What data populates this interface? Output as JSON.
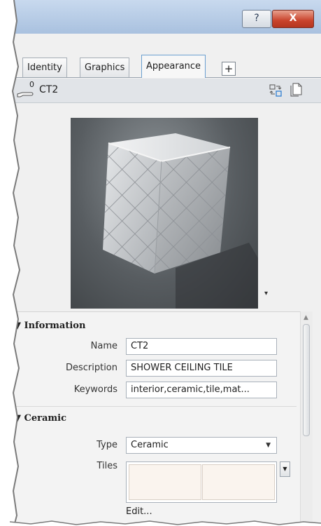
{
  "titlebar": {
    "help_label": "?",
    "close_label": "X"
  },
  "tabs": [
    {
      "label": "Identity",
      "active": false
    },
    {
      "label": "Graphics",
      "active": false
    },
    {
      "label": "Appearance",
      "active": true
    }
  ],
  "add_tab_label": "+",
  "asset": {
    "count": "0",
    "name": "CT2"
  },
  "information": {
    "header": "Information",
    "rows": [
      {
        "label": "Name",
        "value": "CT2"
      },
      {
        "label": "Description",
        "value": "SHOWER CEILING TILE"
      },
      {
        "label": "Keywords",
        "value": "interior,ceramic,tile,mat..."
      }
    ]
  },
  "ceramic": {
    "header": "Ceramic",
    "type_label": "Type",
    "type_value": "Ceramic",
    "tiles_label": "Tiles",
    "edit_label": "Edit..."
  },
  "icons": {
    "collapse": "triangle-down-icon",
    "hand": "hand-pointer-icon",
    "swap": "swap-icon",
    "document": "document-icon"
  },
  "colors": {
    "accent": "#6a9fd1",
    "close": "#c9432c"
  }
}
